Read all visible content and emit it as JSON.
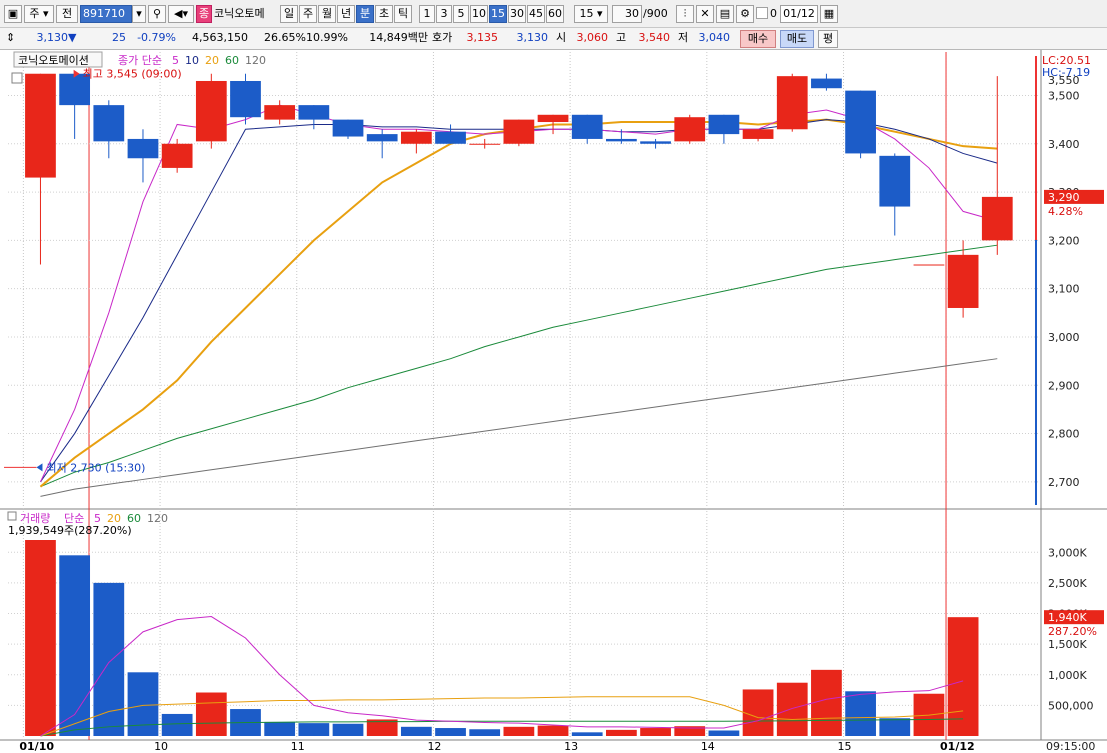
{
  "toolbar": {
    "tab_day": "주",
    "tab_all": "전",
    "code": "891710",
    "stock_name": "코닉오토메",
    "periods": [
      "일",
      "주",
      "월",
      "년",
      "분",
      "초",
      "틱"
    ],
    "intervals": [
      "1",
      "3",
      "5",
      "10",
      "15",
      "30",
      "45",
      "60"
    ],
    "selected_interval": "15",
    "count_select": "15",
    "bars_display": "30",
    "bars_total": "/900",
    "badge": "종",
    "date": "01/12",
    "chk_label": "0"
  },
  "quote": {
    "price": "3,130",
    "arrow": "▼",
    "change": "25",
    "change_pct": "-0.79%",
    "volume": "4,563,150",
    "vol_ratio": "26.65%",
    "turnover": "10.99%",
    "amount": "14,849백만",
    "ask_label": "호가",
    "ask": "3,135",
    "bid": "3,130",
    "open_label": "시",
    "open": "3,060",
    "high_label": "고",
    "high": "3,540",
    "low_label": "저",
    "low": "3,040",
    "buy_label": "매수",
    "sell_label": "매도",
    "eval_label": "평"
  },
  "colors": {
    "up": "#e8261a",
    "down": "#1c5cc8",
    "ma5": "#c828c8",
    "ma10": "#1a2a88",
    "ma20": "#e8a010",
    "ma60": "#1a8a3a",
    "ma120": "#707070"
  },
  "chart_data": [
    {
      "type": "candlestick",
      "title": "코닉오토메이션",
      "ma_label": "종가 단순",
      "ma_periods": [
        "5",
        "10",
        "20",
        "60",
        "120"
      ],
      "x_ticks": [
        "01/10",
        "10",
        "11",
        "12",
        "13",
        "14",
        "15",
        "01/12"
      ],
      "ylim": [
        2650,
        3590
      ],
      "y_ticks": [
        2700,
        2800,
        2900,
        3000,
        3100,
        3200,
        3300,
        3400,
        3500
      ],
      "y_tick_labels": [
        "2,700",
        "2,800",
        "2,900",
        "3,000",
        "3,100",
        "3,200",
        "3,300",
        "3,400",
        "3,500",
        "3,550"
      ],
      "top_labels": {
        "lc": "LC:20.51",
        "hc": "HC:-7.19"
      },
      "current": {
        "label": "3,290",
        "pct": "4.28%",
        "value": 3290
      },
      "annotations": {
        "high": "최고 3,545 (09:00)",
        "high_value": 3545,
        "low": "최저 2,730 (15:30)",
        "low_value": 2730
      },
      "candles": [
        {
          "o": 3330,
          "h": 3545,
          "l": 3150,
          "c": 3545
        },
        {
          "o": 3545,
          "h": 3545,
          "l": 3410,
          "c": 3480
        },
        {
          "o": 3480,
          "h": 3490,
          "l": 3370,
          "c": 3405
        },
        {
          "o": 3410,
          "h": 3430,
          "l": 3320,
          "c": 3370
        },
        {
          "o": 3350,
          "h": 3410,
          "l": 3340,
          "c": 3400
        },
        {
          "o": 3405,
          "h": 3545,
          "l": 3390,
          "c": 3530
        },
        {
          "o": 3530,
          "h": 3545,
          "l": 3440,
          "c": 3455
        },
        {
          "o": 3450,
          "h": 3490,
          "l": 3440,
          "c": 3480
        },
        {
          "o": 3480,
          "h": 3480,
          "l": 3430,
          "c": 3450
        },
        {
          "o": 3450,
          "h": 3450,
          "l": 3410,
          "c": 3415
        },
        {
          "o": 3420,
          "h": 3430,
          "l": 3370,
          "c": 3405
        },
        {
          "o": 3400,
          "h": 3430,
          "l": 3380,
          "c": 3425
        },
        {
          "o": 3425,
          "h": 3440,
          "l": 3400,
          "c": 3400
        },
        {
          "o": 3400,
          "h": 3410,
          "l": 3390,
          "c": 3400
        },
        {
          "o": 3400,
          "h": 3450,
          "l": 3395,
          "c": 3450
        },
        {
          "o": 3445,
          "h": 3460,
          "l": 3420,
          "c": 3460
        },
        {
          "o": 3460,
          "h": 3460,
          "l": 3400,
          "c": 3410
        },
        {
          "o": 3410,
          "h": 3430,
          "l": 3400,
          "c": 3405
        },
        {
          "o": 3405,
          "h": 3410,
          "l": 3390,
          "c": 3400
        },
        {
          "o": 3405,
          "h": 3460,
          "l": 3400,
          "c": 3455
        },
        {
          "o": 3460,
          "h": 3460,
          "l": 3400,
          "c": 3420
        },
        {
          "o": 3410,
          "h": 3430,
          "l": 3405,
          "c": 3430
        },
        {
          "o": 3430,
          "h": 3545,
          "l": 3425,
          "c": 3540
        },
        {
          "o": 3535,
          "h": 3545,
          "l": 3510,
          "c": 3515
        },
        {
          "o": 3510,
          "h": 3510,
          "l": 3370,
          "c": 3380
        },
        {
          "o": 3375,
          "h": 3380,
          "l": 3210,
          "c": 3270
        },
        {
          "o": 3150,
          "h": 3150,
          "l": 3150,
          "c": 3150
        },
        {
          "o": 3060,
          "h": 3200,
          "l": 3040,
          "c": 3170
        },
        {
          "o": 3200,
          "h": 3540,
          "l": 3170,
          "c": 3290
        }
      ],
      "ma5": [
        2700,
        2850,
        3050,
        3280,
        3440,
        3430,
        3450,
        3480,
        3460,
        3440,
        3430,
        3430,
        3425,
        3420,
        3425,
        3430,
        3430,
        3425,
        3420,
        3430,
        3430,
        3430,
        3460,
        3470,
        3450,
        3410,
        3350,
        3260,
        3240
      ],
      "ma10": [
        2700,
        2800,
        2920,
        3040,
        3170,
        3300,
        3430,
        3435,
        3440,
        3440,
        3435,
        3435,
        3430,
        3430,
        3430,
        3430,
        3430,
        3425,
        3425,
        3430,
        3430,
        3430,
        3440,
        3450,
        3445,
        3430,
        3410,
        3380,
        3360
      ],
      "ma20": [
        2690,
        2750,
        2800,
        2850,
        2910,
        2990,
        3060,
        3130,
        3200,
        3260,
        3320,
        3360,
        3400,
        3420,
        3430,
        3440,
        3440,
        3445,
        3445,
        3445,
        3445,
        3440,
        3445,
        3450,
        3440,
        3425,
        3410,
        3395,
        3390
      ],
      "ma60": [
        2690,
        2720,
        2740,
        2765,
        2790,
        2810,
        2830,
        2850,
        2870,
        2895,
        2915,
        2935,
        2955,
        2980,
        3000,
        3020,
        3035,
        3050,
        3065,
        3080,
        3095,
        3110,
        3125,
        3140,
        3150,
        3160,
        3170,
        3180,
        3190
      ],
      "ma120": [
        2670,
        2685,
        2695,
        2705,
        2715,
        2725,
        2735,
        2745,
        2755,
        2765,
        2775,
        2785,
        2795,
        2805,
        2815,
        2825,
        2835,
        2845,
        2855,
        2865,
        2875,
        2885,
        2895,
        2905,
        2915,
        2925,
        2935,
        2945,
        2955
      ]
    },
    {
      "type": "bar",
      "title": "거래량",
      "ma_label": "단순",
      "ma_periods": [
        "5",
        "20",
        "60",
        "120"
      ],
      "info": "1,939,549주(287.20%)",
      "ylim": [
        0,
        3200000
      ],
      "y_ticks": [
        500000,
        1000000,
        1500000,
        2000000,
        2500000,
        3000000
      ],
      "y_tick_labels": [
        "500,000",
        "1,000K",
        "1,500K",
        "2,000K",
        "2,500K",
        "3,000K"
      ],
      "current": {
        "label": "1,940K",
        "pct": "287.20%",
        "value": 1940000
      },
      "values": [
        3200000,
        2950000,
        2500000,
        1040000,
        360000,
        710000,
        440000,
        230000,
        210000,
        200000,
        270000,
        150000,
        130000,
        110000,
        150000,
        170000,
        60000,
        100000,
        130000,
        160000,
        90000,
        760000,
        870000,
        1080000,
        730000,
        290000,
        690000,
        1940000
      ],
      "up": [
        true,
        false,
        false,
        false,
        false,
        true,
        false,
        false,
        false,
        false,
        true,
        false,
        false,
        false,
        true,
        true,
        false,
        true,
        true,
        true,
        false,
        true,
        true,
        true,
        false,
        false,
        true,
        true
      ],
      "ma5": [
        0,
        350000,
        1200000,
        1700000,
        1900000,
        1950000,
        1600000,
        1000000,
        500000,
        380000,
        330000,
        260000,
        240000,
        220000,
        210000,
        180000,
        150000,
        150000,
        140000,
        130000,
        130000,
        250000,
        450000,
        600000,
        680000,
        720000,
        740000,
        900000
      ],
      "ma20": [
        0,
        200000,
        400000,
        500000,
        520000,
        540000,
        560000,
        580000,
        580000,
        590000,
        590000,
        600000,
        610000,
        620000,
        620000,
        630000,
        640000,
        640000,
        640000,
        640000,
        500000,
        300000,
        270000,
        290000,
        300000,
        310000,
        340000,
        410000
      ],
      "ma60": [
        0,
        100000,
        150000,
        180000,
        200000,
        210000,
        220000,
        225000,
        230000,
        230000,
        235000,
        235000,
        240000,
        240000,
        240000,
        240000,
        240000,
        240000,
        240000,
        240000,
        240000,
        245000,
        250000,
        255000,
        260000,
        265000,
        270000,
        280000
      ]
    }
  ],
  "time_label": "09:15:00"
}
